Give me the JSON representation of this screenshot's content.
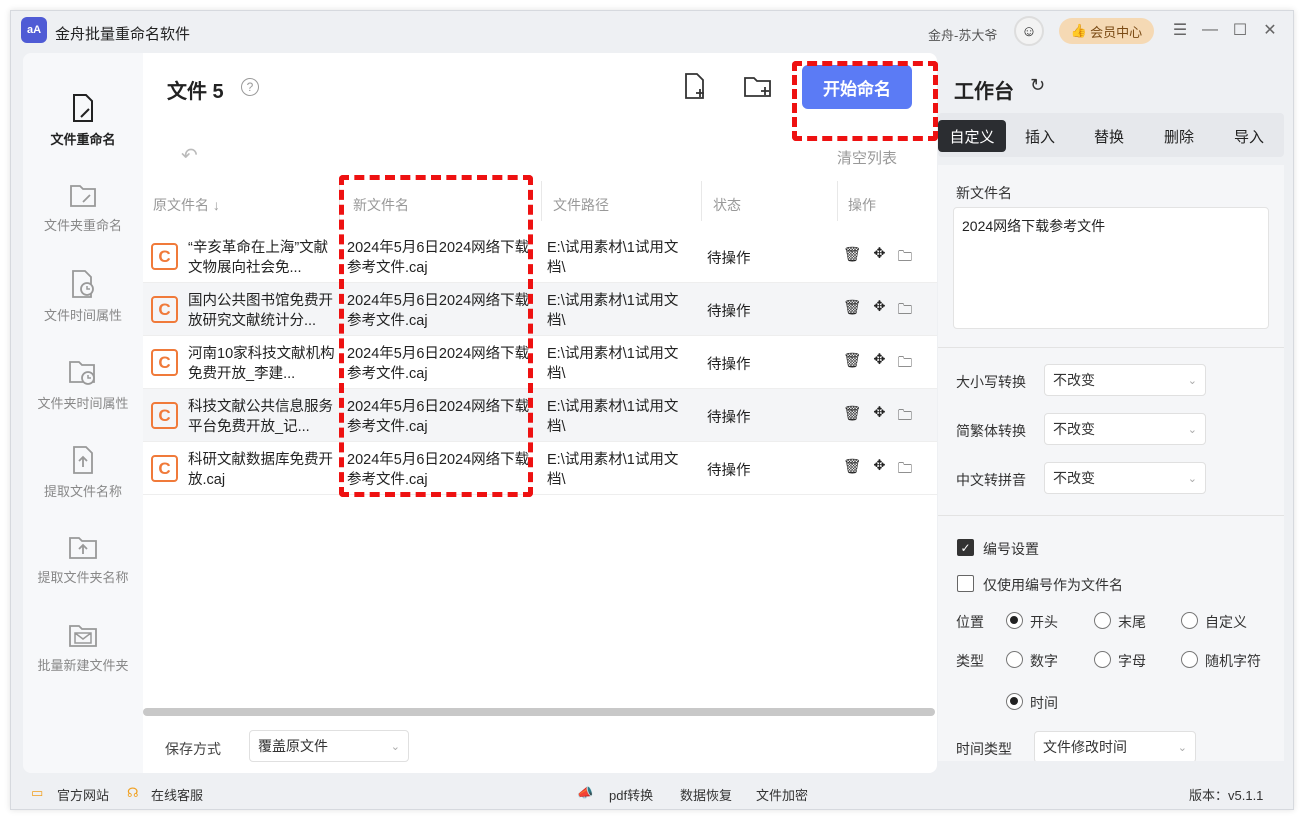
{
  "app": {
    "title": "金舟批量重命名软件",
    "logo_text": "aA",
    "user": "金舟-苏大爷",
    "vip": "会员中心"
  },
  "nav": [
    {
      "label": "文件重命名",
      "icon": "file-edit-icon"
    },
    {
      "label": "文件夹重命名",
      "icon": "folder-edit-icon"
    },
    {
      "label": "文件时间属性",
      "icon": "file-clock-icon"
    },
    {
      "label": "文件夹时间属性",
      "icon": "folder-clock-icon"
    },
    {
      "label": "提取文件名称",
      "icon": "file-upload-icon"
    },
    {
      "label": "提取文件夹名称",
      "icon": "folder-upload-icon"
    },
    {
      "label": "批量新建文件夹",
      "icon": "folder-mail-icon"
    }
  ],
  "files": {
    "title": "文件 5",
    "start_button": "开始命名",
    "clear": "清空列表"
  },
  "table": {
    "headers": {
      "orig": "原文件名 ↓",
      "new": "新文件名",
      "path": "文件路径",
      "state": "状态",
      "ops": "操作"
    },
    "rows": [
      {
        "orig": "“辛亥革命在上海”文献文物展向社会免...",
        "new": "2024年5月6日2024网络下载参考文件.caj",
        "path": "E:\\试用素材\\1试用文档\\",
        "state": "待操作"
      },
      {
        "orig": "国内公共图书馆免费开放研究文献统计分...",
        "new": "2024年5月6日2024网络下载参考文件.caj",
        "path": "E:\\试用素材\\1试用文档\\",
        "state": "待操作"
      },
      {
        "orig": "河南10家科技文献机构免费开放_李建...",
        "new": "2024年5月6日2024网络下载参考文件.caj",
        "path": "E:\\试用素材\\1试用文档\\",
        "state": "待操作"
      },
      {
        "orig": "科技文献公共信息服务平台免费开放_记...",
        "new": "2024年5月6日2024网络下载参考文件.caj",
        "path": "E:\\试用素材\\1试用文档\\",
        "state": "待操作"
      },
      {
        "orig": "科研文献数据库免费开放.caj",
        "new": "2024年5月6日2024网络下载参考文件.caj",
        "path": "E:\\试用素材\\1试用文档\\",
        "state": "待操作"
      }
    ]
  },
  "save": {
    "label": "保存方式",
    "value": "覆盖原文件"
  },
  "workbench": {
    "title": "工作台",
    "tabs": [
      "自定义",
      "插入",
      "替换",
      "删除",
      "导入"
    ],
    "new_name_label": "新文件名",
    "new_name_value": "2024网络下载参考文件",
    "case_label": "大小写转换",
    "case_value": "不改变",
    "trad_label": "简繁体转换",
    "trad_value": "不改变",
    "pinyin_label": "中文转拼音",
    "pinyin_value": "不改变",
    "numbering_label": "编号设置",
    "only_number_label": "仅使用编号作为文件名",
    "position_label": "位置",
    "position_options": [
      "开头",
      "末尾",
      "自定义"
    ],
    "type_label": "类型",
    "type_options": [
      "数字",
      "字母",
      "随机字符"
    ],
    "type_time": "时间",
    "time_type_label": "时间类型",
    "time_type_value": "文件修改时间"
  },
  "footer": {
    "site": "官方网站",
    "service": "在线客服",
    "pdf": "pdf转换",
    "recover": "数据恢复",
    "encrypt": "文件加密",
    "version": "版本：v5.1.1"
  },
  "colors": {
    "accent": "#5b7bf5",
    "highlight": "#ee1111",
    "vip": "#f5d9b4",
    "file_icon": "#f07a3a"
  }
}
